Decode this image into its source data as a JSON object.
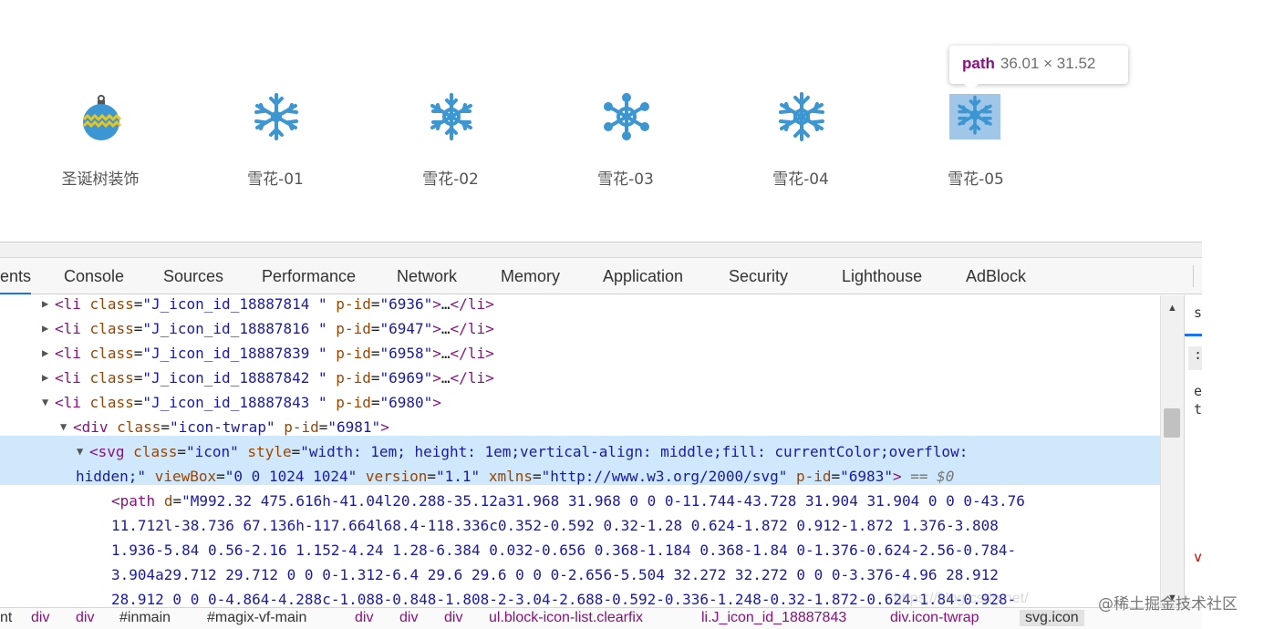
{
  "colors": {
    "icon_blue": "#3c96d2",
    "ornament_yellow": "#e8c41f",
    "highlight": "#6fa8dc",
    "tag_purple": "#881280",
    "attr_brown": "#994500",
    "value_blue": "#1a1aa6"
  },
  "gallery": {
    "items": [
      {
        "label": "圣诞树装饰",
        "icon": "ornament-icon"
      },
      {
        "label": "雪花-01",
        "icon": "snowflake-icon"
      },
      {
        "label": "雪花-02",
        "icon": "snowflake-icon"
      },
      {
        "label": "雪花-03",
        "icon": "snowflake-icon"
      },
      {
        "label": "雪花-04",
        "icon": "snowflake-icon"
      },
      {
        "label": "雪花-05",
        "icon": "snowflake-icon"
      }
    ],
    "tooltip": {
      "tag": "path",
      "dims": "36.01 × 31.52"
    }
  },
  "tabs": [
    "ents",
    "Console",
    "Sources",
    "Performance",
    "Network",
    "Memory",
    "Application",
    "Security",
    "Lighthouse",
    "AdBlock"
  ],
  "dom": {
    "li_rows": [
      {
        "class_val": "\"J_icon_id_18887814 \"",
        "pid_val": "\"6936\""
      },
      {
        "class_val": "\"J_icon_id_18887816 \"",
        "pid_val": "\"6947\""
      },
      {
        "class_val": "\"J_icon_id_18887839 \"",
        "pid_val": "\"6958\""
      },
      {
        "class_val": "\"J_icon_id_18887842 \"",
        "pid_val": "\"6969\""
      }
    ],
    "li_open": {
      "class_val": "\"J_icon_id_18887843 \"",
      "pid_val": "\"6980\""
    },
    "div_row": {
      "class_val": "\"icon-twrap\"",
      "pid_val": "\"6981\""
    },
    "svg_row": {
      "class_val": "\"icon\"",
      "style_val_1": "\"width: 1em; height: 1em;vertical-align: middle;fill: currentColor;overflow:",
      "style_val_2": "hidden;\"",
      "viewbox_val": "\"0 0 1024 1024\"",
      "version_val": "\"1.1\"",
      "xmlns_val": "\"http://www.w3.org/2000/svg\"",
      "pid_val": "\"6983\"",
      "selected_marker": "== $0"
    },
    "path_lines": [
      "\"M992.32 475.616h-41.04l20.288-35.12a31.968 31.968 0 0 0-11.744-43.728 31.904 31.904 0 0 0-43.76",
      "11.712l-38.736 67.136h-117.664l68.4-118.336c0.352-0.592 0.32-1.28 0.624-1.872 0.912-1.872 1.376-3.808",
      "1.936-5.84 0.56-2.16 1.152-4.24 1.28-6.384 0.032-0.656 0.368-1.184 0.368-1.84 0-1.376-0.624-2.56-0.784-",
      "3.904a29.712 29.712 0 0 0-1.312-6.4 29.6 29.6 0 0 0-2.656-5.504 32.272 32.272 0 0 0-3.376-4.96 28.912",
      "28.912 0 0 0-4.864-4.288c-1.088-0.848-1.808-2-3.04-2.688-0.592-0.336-1.248-0.32-1.872-0.624-1.84-0.928-"
    ]
  },
  "side_letters": [
    "s",
    ":",
    "e",
    "t",
    "v"
  ],
  "breadcrumb": [
    "nt",
    "div",
    "div",
    "#inmain",
    "#magix-vf-main",
    "div",
    "div",
    "div",
    "ul.block-icon-list.clearfix",
    "li.J_icon_id_18887843",
    "div.icon-twrap",
    "svg.icon"
  ],
  "watermark": "@稀土掘金技术社区",
  "watermark_url": "https://blog.csdn.net/"
}
